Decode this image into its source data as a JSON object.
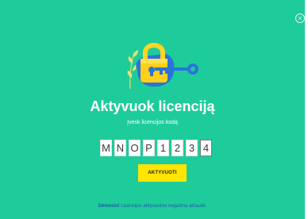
{
  "dialog": {
    "title": "Aktyvuok licenciją",
    "close_symbol": "×"
  },
  "code_entry": {
    "label": "Įvesk licencijos kodą",
    "chars": [
      "M",
      "N",
      "O",
      "P",
      "1",
      "2",
      "3",
      "4"
    ]
  },
  "activate_button": {
    "label": "AKTYVUOTI"
  },
  "notice": {
    "emphasis": "Dėmesio!",
    "text": "Licencijos aktyvavimo negalima atšaukti."
  },
  "colors": {
    "background": "#1ecc9b",
    "button": "#ffe600",
    "notice_text": "#1f5ba6"
  },
  "icons": [
    "padlock-illustration",
    "key-icon",
    "leaf-icon",
    "close-icon"
  ]
}
